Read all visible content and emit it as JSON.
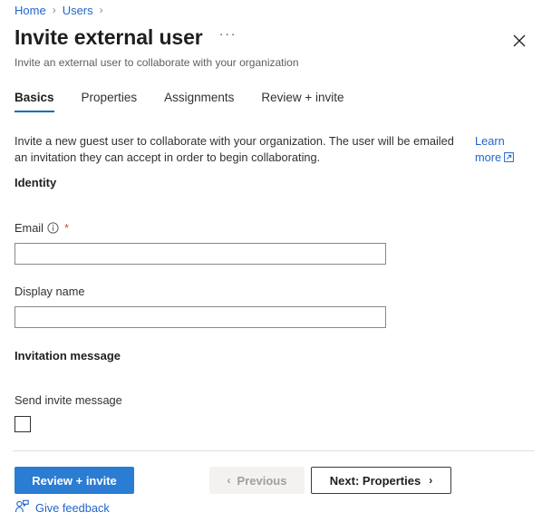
{
  "breadcrumb": {
    "items": [
      {
        "label": "Home",
        "separator": "›"
      },
      {
        "label": "Users",
        "separator": "›"
      }
    ]
  },
  "header": {
    "title": "Invite external user",
    "ellipsis_label": "···",
    "subtitle": "Invite an external user to collaborate with your organization",
    "close_icon": "close-icon"
  },
  "tabs": [
    {
      "label": "Basics",
      "active": true
    },
    {
      "label": "Properties",
      "active": false
    },
    {
      "label": "Assignments",
      "active": false
    },
    {
      "label": "Review + invite",
      "active": false
    }
  ],
  "intro": {
    "text": "Invite a new guest user to collaborate with your organization. The user will be emailed an invitation they can accept in order to begin collaborating.",
    "learn_more": "Learn more",
    "learn_more_icon": "external-link-icon"
  },
  "sections": {
    "identity": {
      "heading": "Identity",
      "email": {
        "label": "Email",
        "info_icon": "info-icon",
        "required_marker": "*",
        "value": "",
        "placeholder": ""
      },
      "display_name": {
        "label": "Display name",
        "value": "",
        "placeholder": ""
      }
    },
    "invitation_message": {
      "heading": "Invitation message",
      "send_invite": {
        "label": "Send invite message",
        "checked": false
      }
    }
  },
  "footer": {
    "review_invite": "Review + invite",
    "previous": "Previous",
    "previous_chevron": "‹",
    "previous_disabled": true,
    "next": "Next: Properties",
    "next_chevron": "›",
    "give_feedback": "Give feedback",
    "feedback_icon": "feedback-person-icon"
  },
  "colors": {
    "accent": "#2b7cd3",
    "link": "#2266cc",
    "tab_underline": "#0f6cbd",
    "required_star": "#c4553f",
    "text": "#323130",
    "muted": "#605e5c"
  }
}
